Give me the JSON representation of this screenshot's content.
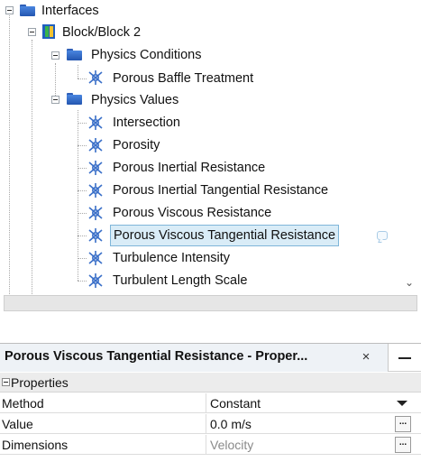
{
  "tree": {
    "interfaces": "Interfaces",
    "block": "Block/Block 2",
    "physics_conditions": "Physics Conditions",
    "porous_baffle": "Porous Baffle Treatment",
    "physics_values": "Physics Values",
    "values": [
      "Intersection",
      "Porosity",
      "Porous Inertial Resistance",
      "Porous Inertial Tangential Resistance",
      "Porous Viscous Resistance",
      "Porous Viscous Tangential Resistance",
      "Turbulence Intensity",
      "Turbulent Length Scale"
    ],
    "selected_index": 5
  },
  "properties": {
    "title": "Porous Viscous Tangential Resistance - Proper...",
    "close_glyph": "×",
    "section": "Properties",
    "rows": [
      {
        "name": "Method",
        "value": "Constant"
      },
      {
        "name": "Value",
        "value": "0.0 m/s"
      },
      {
        "name": "Dimensions",
        "value": "Velocity"
      }
    ],
    "ellipsis": "..."
  },
  "colors": {
    "selection_bg": "#d9ecf7",
    "selection_border": "#7fb6d9",
    "folder_blue": "#2f6fd0",
    "physics_icon_blue": "#3a6fc8"
  }
}
